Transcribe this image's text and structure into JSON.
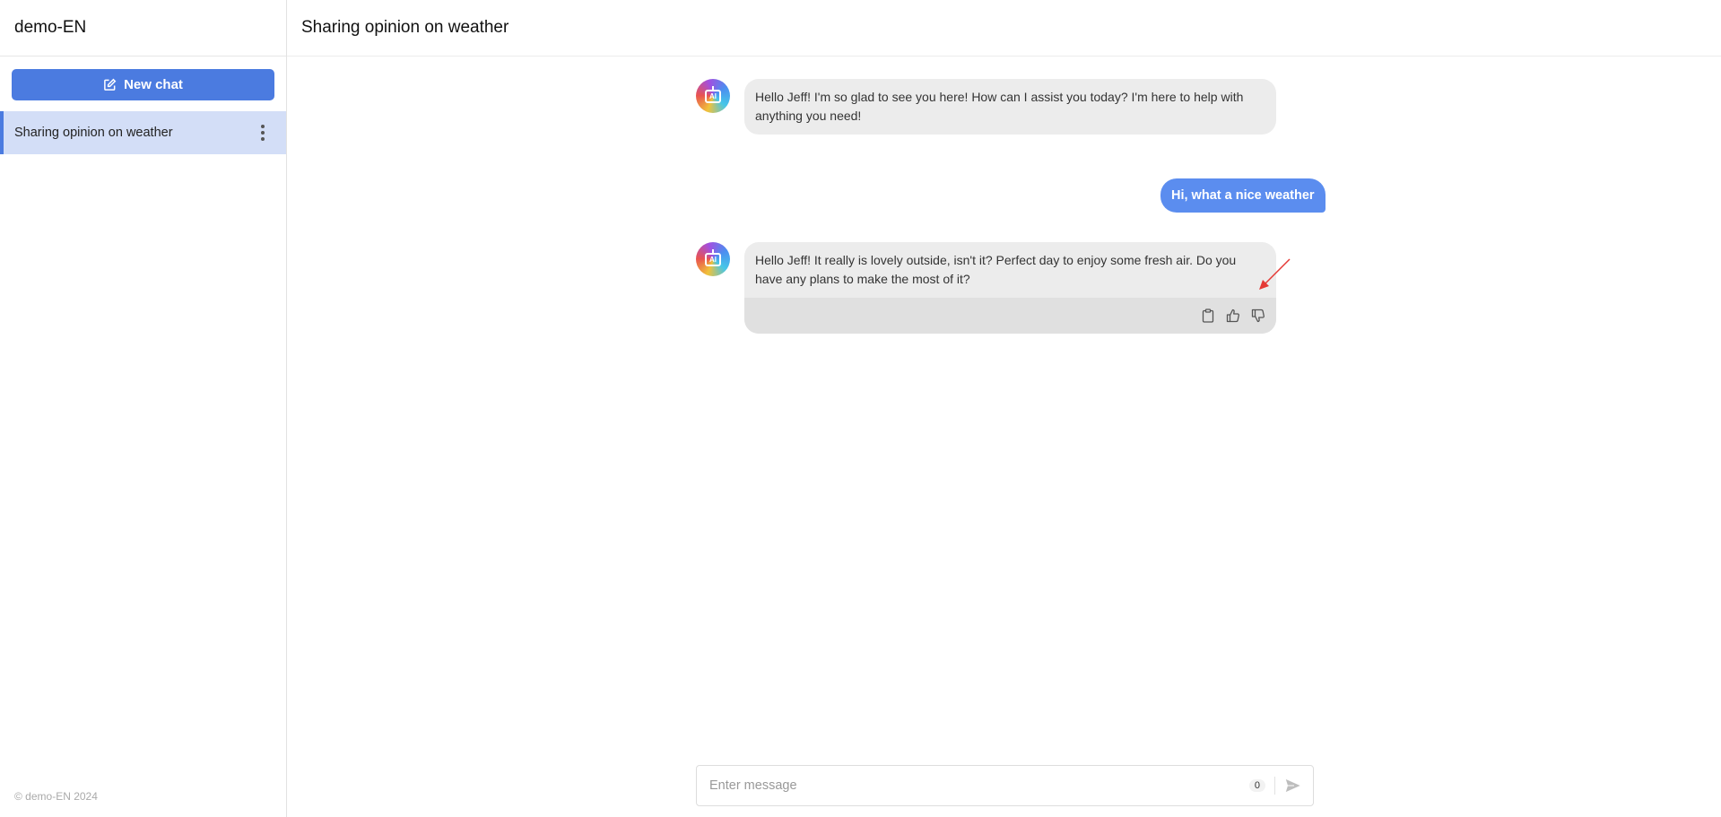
{
  "sidebar": {
    "app_title": "demo-EN",
    "new_chat_label": "New chat",
    "chats": [
      {
        "label": "Sharing opinion on weather",
        "active": true
      }
    ],
    "footer": "© demo-EN 2024"
  },
  "main": {
    "title": "Sharing opinion on weather",
    "messages": [
      {
        "role": "assistant",
        "text": "Hello Jeff! I'm so glad to see you here! How can I assist you today? I'm here to help with anything you need!"
      },
      {
        "role": "user",
        "text": "Hi, what a nice weather"
      },
      {
        "role": "assistant",
        "text": "Hello Jeff! It really is lovely outside, isn't it? Perfect day to enjoy some fresh air. Do you have any plans to make the most of it?",
        "actions": [
          "clipboard-icon",
          "thumbs-up-icon",
          "thumbs-down-icon"
        ]
      }
    ],
    "input": {
      "placeholder": "Enter message",
      "value": "",
      "char_count": "0"
    }
  },
  "colors": {
    "accent": "#4b7be0",
    "user_bubble": "#5b8def",
    "active_chat_bg": "#d3def7",
    "ai_bubble": "#ececec",
    "annotation": "#e53935"
  }
}
